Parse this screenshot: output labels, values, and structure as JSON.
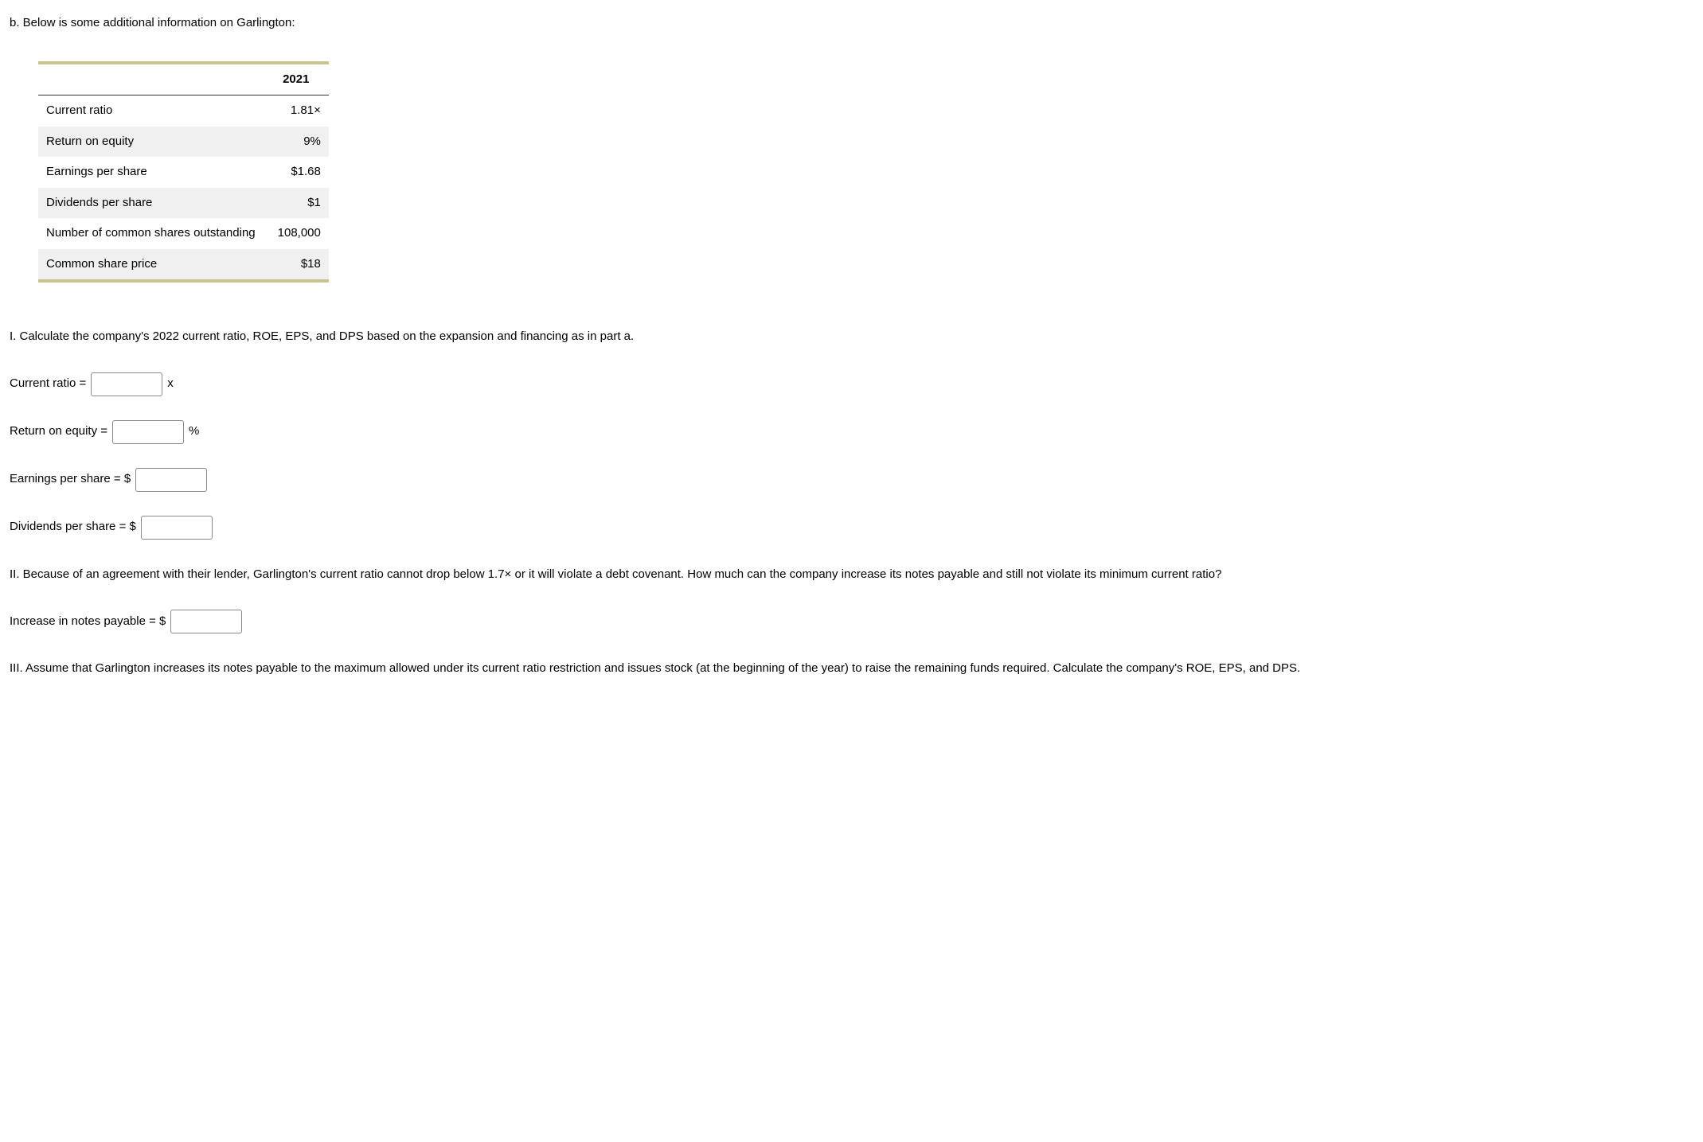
{
  "intro": "b. Below is some additional information on Garlington:",
  "table": {
    "year_header": "2021",
    "rows": [
      {
        "label": "Current ratio",
        "value": "1.81×"
      },
      {
        "label": "Return on equity",
        "value": "9%"
      },
      {
        "label": "Earnings per share",
        "value": "$1.68"
      },
      {
        "label": "Dividends per share",
        "value": "$1"
      },
      {
        "label": "Number of common shares outstanding",
        "value": "108,000"
      },
      {
        "label": "Common share price",
        "value": "$18"
      }
    ]
  },
  "section_I": "I. Calculate the company's 2022 current ratio, ROE, EPS, and DPS based on the expansion and financing as in part a.",
  "inputs": {
    "current_ratio_label": "Current ratio =",
    "current_ratio_suffix": "x",
    "roe_label": "Return on equity =",
    "roe_suffix": "%",
    "eps_label": "Earnings per share = $",
    "dps_label": "Dividends per share = $"
  },
  "section_II": "II. Because of an agreement with their lender, Garlington's current ratio cannot drop below 1.7× or it will violate a debt covenant. How much can the company increase its notes payable and still not violate its minimum current ratio?",
  "notes_payable_label": "Increase in notes payable = $",
  "section_III": "III. Assume that Garlington increases its notes payable to the maximum allowed under its current ratio restriction and issues stock (at the beginning of the year) to raise the remaining funds required. Calculate the company's ROE, EPS, and DPS."
}
